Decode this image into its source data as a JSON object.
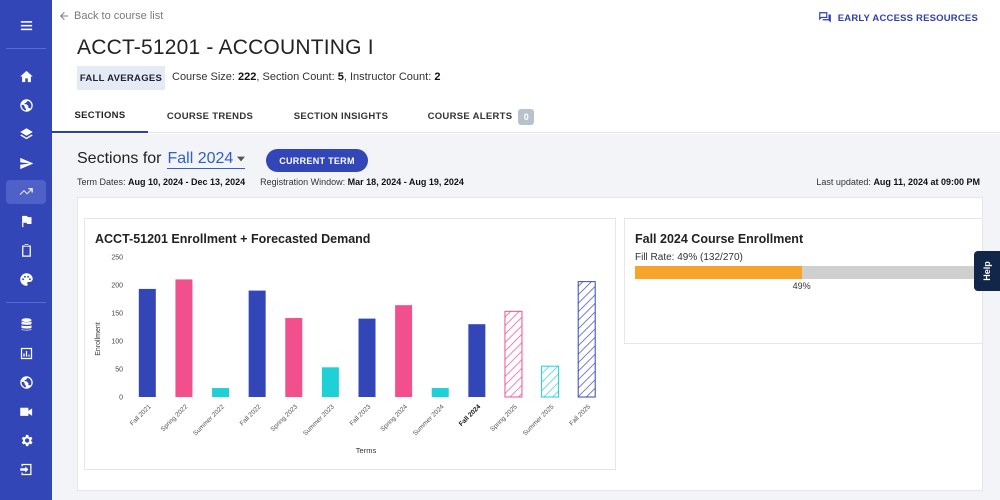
{
  "sidebar": {
    "items": [
      {
        "icon": "menu-icon"
      },
      {
        "icon": "home-icon"
      },
      {
        "icon": "globe-icon"
      },
      {
        "icon": "layers-icon"
      },
      {
        "icon": "send-icon"
      },
      {
        "icon": "trending-icon",
        "active": true
      },
      {
        "icon": "flag-icon"
      },
      {
        "icon": "clipboard-icon"
      },
      {
        "icon": "palette-icon"
      },
      {
        "icon": "database-icon"
      },
      {
        "icon": "bar-chart-icon"
      },
      {
        "icon": "globe-icon"
      },
      {
        "icon": "video-icon"
      },
      {
        "icon": "gear-icon"
      },
      {
        "icon": "logout-icon"
      }
    ]
  },
  "header": {
    "back_label": "Back to course list",
    "early_access_label": "EARLY ACCESS RESOURCES",
    "course_title": "ACCT-51201 - ACCOUNTING I",
    "badge": "FALL AVERAGES",
    "stats": {
      "size_label": "Course Size: ",
      "size_value": "222",
      "section_label": ", Section Count: ",
      "section_value": "5",
      "instructor_label": ", Instructor Count: ",
      "instructor_value": "2"
    }
  },
  "tabs": [
    {
      "label": "SECTIONS",
      "active": true
    },
    {
      "label": "COURSE TRENDS"
    },
    {
      "label": "SECTION INSIGHTS"
    },
    {
      "label": "COURSE ALERTS",
      "count": "0"
    }
  ],
  "term": {
    "prefix": "Sections for",
    "selected": "Fall 2024",
    "current_term_button": "CURRENT TERM",
    "term_dates_label": "Term Dates: ",
    "term_dates_value": "Aug 10, 2024 - Dec 13, 2024",
    "registration_label": "Registration Window: ",
    "registration_value": "Mar 18, 2024 - Aug 19, 2024",
    "updated_label": "Last updated: ",
    "updated_value": "Aug 11, 2024 at 09:00 PM"
  },
  "enrollment_card": {
    "title": "Fall 2024 Course Enrollment",
    "fill_label": "Fill Rate: 49% (132/270)",
    "fill_fraction": 0.49,
    "fill_pct_text": "49%"
  },
  "help_label": "Help",
  "colors": {
    "sidebar": "#3346b8",
    "fall": "#3346b8",
    "spring": "#f24f8d",
    "summer": "#1ed1d6",
    "fill": "#f7a42b",
    "track": "#cfcfcf"
  },
  "chart_data": {
    "type": "bar",
    "title": "ACCT-51201 Enrollment + Forecasted Demand",
    "xlabel": "Terms",
    "ylabel": "Enrollment",
    "ylim": [
      0,
      250
    ],
    "yticks": [
      0,
      50,
      100,
      150,
      200,
      250
    ],
    "grid": false,
    "categories": [
      "Fall 2021",
      "Spring 2022",
      "Summer 2022",
      "Fall 2022",
      "Spring 2023",
      "Summer 2023",
      "Fall 2023",
      "Spring 2024",
      "Summer 2024",
      "Fall 2024",
      "Spring 2025",
      "Summer 2025",
      "Fall 2025"
    ],
    "values": [
      193,
      210,
      16,
      190,
      141,
      53,
      140,
      164,
      16,
      130,
      153,
      55,
      206
    ],
    "season": [
      "fall",
      "spring",
      "summer",
      "fall",
      "spring",
      "summer",
      "fall",
      "spring",
      "summer",
      "fall",
      "spring",
      "summer",
      "fall"
    ],
    "forecast": [
      false,
      false,
      false,
      false,
      false,
      false,
      false,
      false,
      false,
      false,
      true,
      true,
      true
    ],
    "highlight_category": "Fall 2024"
  }
}
